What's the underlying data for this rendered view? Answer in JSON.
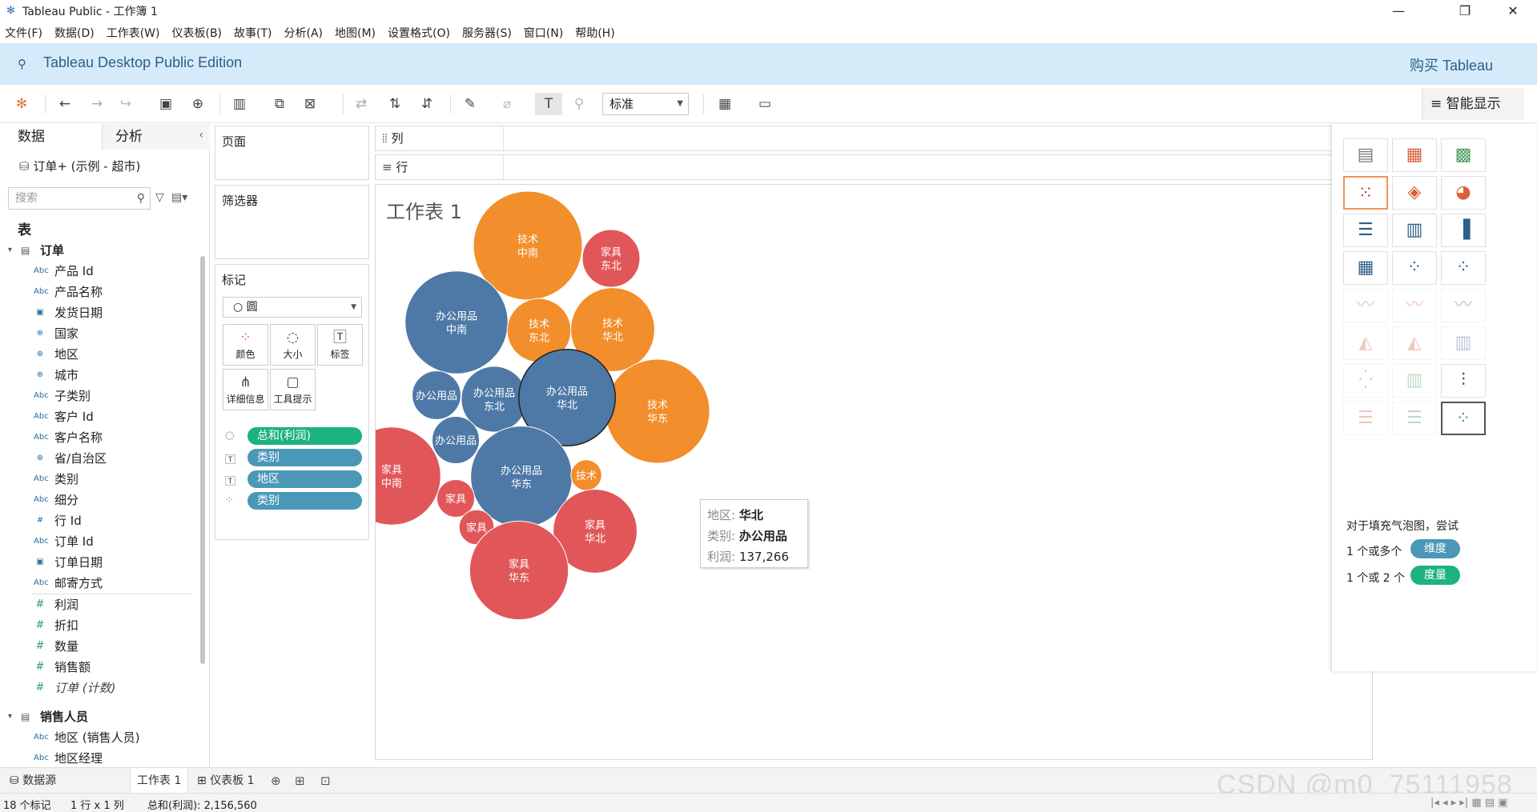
{
  "window": {
    "title": "Tableau Public - 工作簿 1",
    "minimize": "—",
    "restore": "❐",
    "close": "✕"
  },
  "menu": [
    "文件(F)",
    "数据(D)",
    "工作表(W)",
    "仪表板(B)",
    "故事(T)",
    "分析(A)",
    "地图(M)",
    "设置格式(O)",
    "服务器(S)",
    "窗口(N)",
    "帮助(H)"
  ],
  "banner": {
    "edition": "Tableau Desktop Public Edition",
    "buy": "购买 Tableau"
  },
  "toolbar": {
    "fit_value": "标准",
    "smart_show": "智能显示"
  },
  "left": {
    "tab_data": "数据",
    "tab_analysis": "分析",
    "datasource": "订单+ (示例 - 超市)",
    "search_placeholder": "搜索",
    "tables_header": "表",
    "groups": [
      {
        "name": "订单",
        "fields": [
          {
            "icon": "Abc",
            "name": "产品 Id"
          },
          {
            "icon": "Abc",
            "name": "产品名称"
          },
          {
            "icon": "date",
            "name": "发货日期"
          },
          {
            "icon": "geo",
            "name": "国家"
          },
          {
            "icon": "geo",
            "name": "地区"
          },
          {
            "icon": "geo",
            "name": "城市"
          },
          {
            "icon": "Abc",
            "name": "子类别"
          },
          {
            "icon": "Abc",
            "name": "客户 Id"
          },
          {
            "icon": "Abc",
            "name": "客户名称"
          },
          {
            "icon": "geo",
            "name": "省/自治区"
          },
          {
            "icon": "Abc",
            "name": "类别"
          },
          {
            "icon": "Abc",
            "name": "细分"
          },
          {
            "icon": "#d",
            "name": "行 Id"
          },
          {
            "icon": "Abc",
            "name": "订单 Id"
          },
          {
            "icon": "date",
            "name": "订单日期"
          },
          {
            "icon": "Abc",
            "name": "邮寄方式"
          },
          {
            "icon": "#",
            "name": "利润"
          },
          {
            "icon": "#",
            "name": "折扣"
          },
          {
            "icon": "#",
            "name": "数量"
          },
          {
            "icon": "#",
            "name": "销售额"
          },
          {
            "icon": "#",
            "name": "订单 (计数)",
            "italic": true
          }
        ]
      },
      {
        "name": "销售人员",
        "fields": [
          {
            "icon": "Abc",
            "name": "地区 (销售人员)"
          },
          {
            "icon": "Abc",
            "name": "地区经理"
          }
        ]
      }
    ]
  },
  "cards": {
    "pages": "页面",
    "filters": "筛选器",
    "marks": "标记",
    "mark_type": "圆",
    "buttons": {
      "color": "颜色",
      "size": "大小",
      "label": "标签",
      "detail": "详细信息",
      "tooltip": "工具提示"
    },
    "pills": [
      {
        "icon": "size",
        "text": "总和(利润)",
        "color": "#1db37e"
      },
      {
        "icon": "label",
        "text": "类别",
        "color": "#4a97b8"
      },
      {
        "icon": "label",
        "text": "地区",
        "color": "#4a97b8"
      },
      {
        "icon": "color",
        "text": "类别",
        "color": "#4a97b8"
      }
    ]
  },
  "shelves": {
    "columns": "列",
    "rows": "行"
  },
  "view": {
    "sheet_title": "工作表 1"
  },
  "colors": {
    "技术": "#f28e2b",
    "办公用品": "#4e79a7",
    "家具": "#e15759"
  },
  "chart_data": {
    "type": "packed-bubble",
    "size_measure": "总和(利润)",
    "color_dimension": "类别",
    "label_dimensions": [
      "类别",
      "地区"
    ],
    "bubbles": [
      {
        "category": "技术",
        "region": "中南",
        "label": [
          "技术",
          "中南"
        ],
        "value": 175000
      },
      {
        "category": "家具",
        "region": "东北",
        "label": [
          "家具",
          "东北"
        ],
        "value": 49000
      },
      {
        "category": "办公用品",
        "region": "中南",
        "label": [
          "办公用品",
          "中南"
        ],
        "value": 156000
      },
      {
        "category": "技术",
        "region": "东北",
        "label": [
          "技术",
          "东北"
        ],
        "value": 60000
      },
      {
        "category": "技术",
        "region": "华北",
        "label": [
          "技术",
          "华北"
        ],
        "value": 104000
      },
      {
        "category": "技术",
        "region": "华东",
        "label": [
          "技术",
          "华东"
        ],
        "value": 160000
      },
      {
        "category": "办公用品",
        "region": "西南",
        "label": [
          "办公用品"
        ],
        "value": 35000
      },
      {
        "category": "办公用品",
        "region": "东北",
        "label": [
          "办公用品",
          "东北"
        ],
        "value": 64000
      },
      {
        "category": "办公用品",
        "region": "华北",
        "label": [
          "办公用品",
          "华北"
        ],
        "value": 137266,
        "highlighted": true
      },
      {
        "category": "办公用品",
        "region": "西北",
        "label": [
          "办公用品"
        ],
        "value": 33000
      },
      {
        "category": "家具",
        "region": "中南",
        "label": [
          "家具",
          "中南"
        ],
        "value": 142000
      },
      {
        "category": "办公用品",
        "region": "华东",
        "label": [
          "办公用品",
          "华东"
        ],
        "value": 152000
      },
      {
        "category": "技术",
        "region": "西南",
        "label": [
          "技术"
        ],
        "value": 14000
      },
      {
        "category": "家具",
        "region": "西南",
        "label": [
          "家具"
        ],
        "value": 21000
      },
      {
        "category": "家具",
        "region": "西北",
        "label": [
          "家具"
        ],
        "value": 18000
      },
      {
        "category": "家具",
        "region": "华北",
        "label": [
          "家具",
          "华北"
        ],
        "value": 104000
      },
      {
        "category": "家具",
        "region": "华东",
        "label": [
          "家具",
          "华东"
        ],
        "value": 144000
      }
    ]
  },
  "tooltip": {
    "rows": [
      {
        "key": "地区:",
        "value": "华北"
      },
      {
        "key": "类别:",
        "value": "办公用品"
      },
      {
        "key": "利润:",
        "value": "137,266"
      }
    ]
  },
  "showme": {
    "hint_title": "对于填充气泡图，尝试",
    "hint_dim_prefix": "1 个或多个",
    "hint_dim_pill": "维度",
    "hint_meas_prefix": "1 个或 2 个",
    "hint_meas_pill": "度量"
  },
  "tabs": {
    "datasource": "数据源",
    "sheet": "工作表 1",
    "dashboard": "仪表板 1"
  },
  "status": {
    "marks": "18 个标记",
    "rowscols": "1 行 x 1 列",
    "sum": "总和(利润): 2,156,560"
  },
  "watermark": "CSDN @m0_75111958"
}
